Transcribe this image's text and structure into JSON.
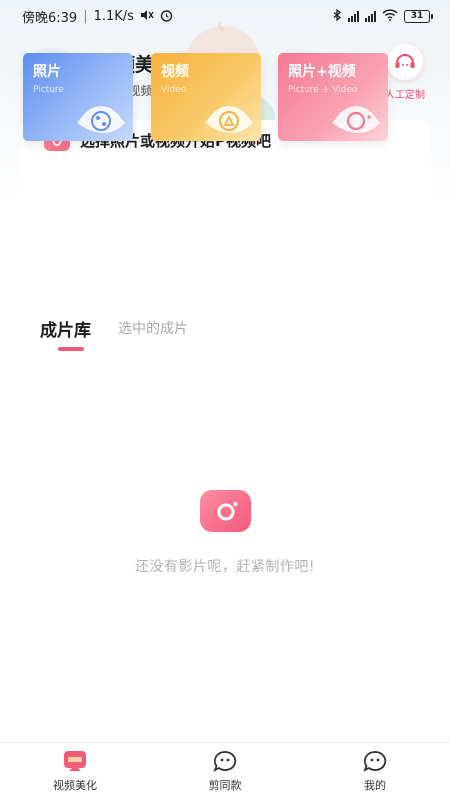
{
  "status_bar": {
    "time": "傍晚6:39",
    "speed": "1.1K/s",
    "battery": "31"
  },
  "header": {
    "title": "视频美化",
    "subtitle": "轻松P视频",
    "service_label": "人工定制"
  },
  "card": {
    "title": "选择照片或视频开始P视频吧",
    "tiles": [
      {
        "title": "照片",
        "subtitle": "Picture",
        "icon": "film-reel-icon",
        "color": "#5d8ef0"
      },
      {
        "title": "视频",
        "subtitle": "Video",
        "icon": "play-triangle-icon",
        "color": "#f6b13d"
      },
      {
        "title": "照片+视频",
        "subtitle": "Picture + Video",
        "icon": "camera-lens-icon",
        "color": "#f57891"
      }
    ]
  },
  "library": {
    "tabs": [
      "成片库",
      "选中的成片"
    ],
    "empty_text": "还没有影片呢，赶紧制作吧!"
  },
  "bottom_nav": [
    {
      "label": "视频美化",
      "icon": "video-badge-icon"
    },
    {
      "label": "剪同款",
      "icon": "smiley-face-icon"
    },
    {
      "label": "我的",
      "icon": "smiley-face-icon"
    }
  ],
  "colors": {
    "accent": "#f05b7a",
    "service": "#ee4d6e",
    "empty_text": "#b2b2b2"
  }
}
